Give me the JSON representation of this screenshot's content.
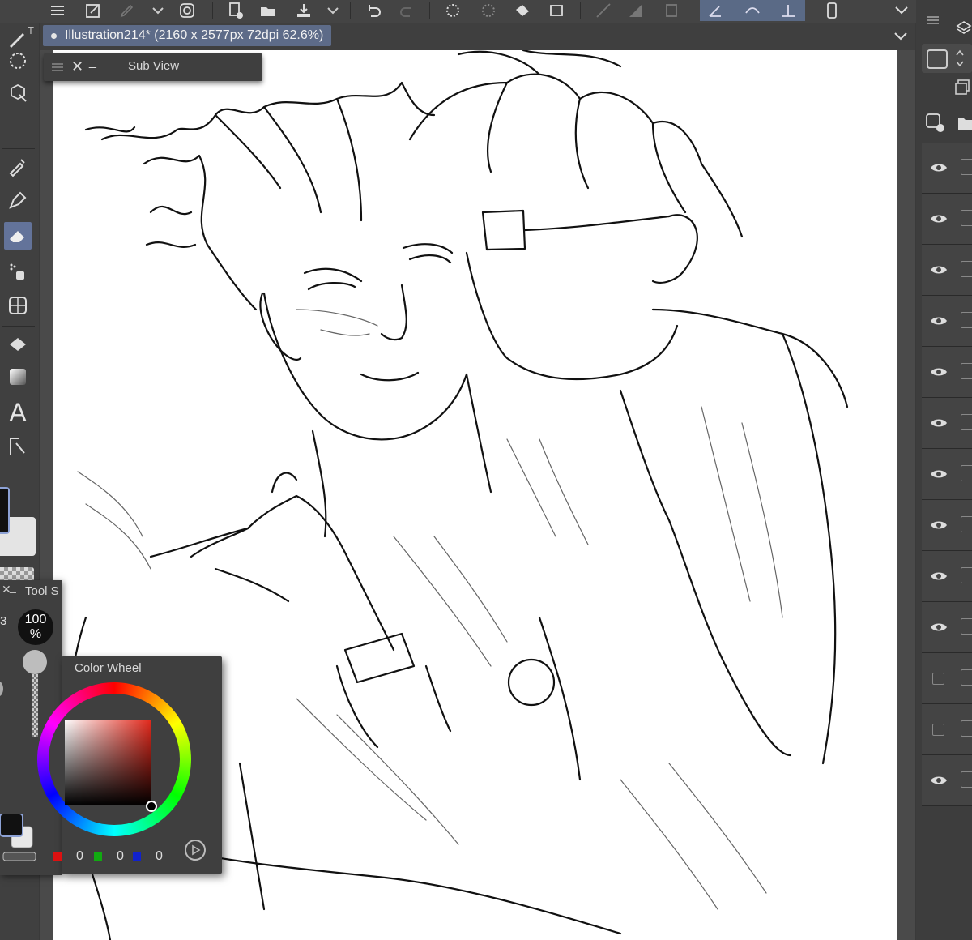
{
  "document": {
    "tab_title": "Illustration214* (2160 x 2577px 72dpi 62.6%)"
  },
  "sub_view": {
    "title": "Sub View"
  },
  "tool_settings": {
    "title": "Tool S",
    "opacity_value": "100",
    "opacity_unit": "%",
    "partial_digit": "3"
  },
  "color_wheel": {
    "title": "Color Wheel",
    "r": "0",
    "g": "0",
    "b": "0"
  },
  "tool_text_glyph": "A",
  "left_partial_label": "T",
  "colors": {
    "accent": "#63739a",
    "tab_bg": "#5d6b88",
    "panel_bg": "#3f3f3f"
  },
  "layers": {
    "visibility": [
      "eye",
      "eye",
      "eye",
      "eye",
      "eye",
      "eye",
      "eye",
      "eye",
      "eye",
      "eye",
      "box",
      "box",
      "eye"
    ]
  }
}
